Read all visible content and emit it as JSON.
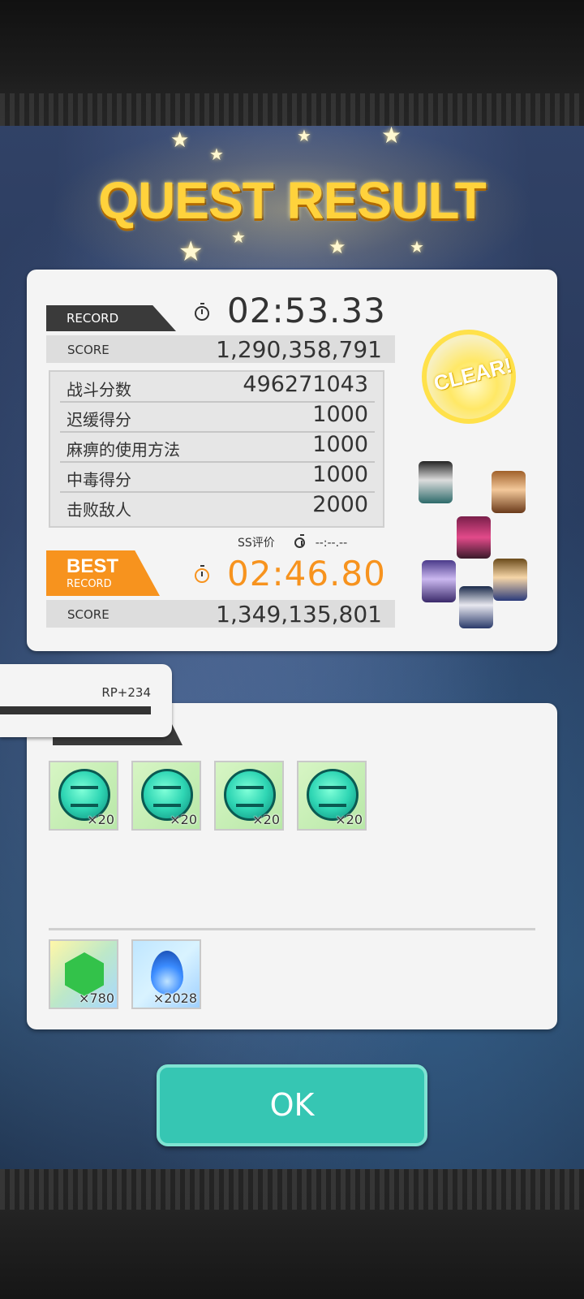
{
  "header": {
    "title": "QUEST RESULT"
  },
  "record": {
    "tag": "RECORD",
    "time": "02:53.33",
    "score_label": "SCORE",
    "score_value": "1,290,358,791",
    "details": [
      {
        "label": "战斗分数",
        "value": "496271043"
      },
      {
        "label": "迟缓得分",
        "value": "1000"
      },
      {
        "label": "麻痹的使用方法",
        "value": "1000"
      },
      {
        "label": "中毒得分",
        "value": "1000"
      },
      {
        "label": "击败敌人",
        "value": "2000"
      }
    ],
    "ss_label": "SS评价",
    "ss_time": "--:--.--"
  },
  "best": {
    "tag_line1": "BEST",
    "tag_line2": "RECORD",
    "time": "02:46.80",
    "score_label": "SCORE",
    "score_value": "1,349,135,801"
  },
  "badge": {
    "text": "CLEAR!"
  },
  "rp": {
    "text": "RP+234"
  },
  "rewards": {
    "items": [
      {
        "icon": "teal-coin-icon",
        "count": "×20"
      },
      {
        "icon": "teal-coin-icon",
        "count": "×20"
      },
      {
        "icon": "teal-coin-icon",
        "count": "×20"
      },
      {
        "icon": "teal-coin-icon",
        "count": "×20"
      }
    ],
    "currencies": [
      {
        "icon": "green-gem-icon",
        "count": "×780"
      },
      {
        "icon": "blue-flame-icon",
        "count": "×2028"
      }
    ]
  },
  "actions": {
    "ok_label": "OK"
  },
  "colors": {
    "accent": "#36c6b3",
    "best": "#f7931e",
    "title": "#ffd23c"
  }
}
